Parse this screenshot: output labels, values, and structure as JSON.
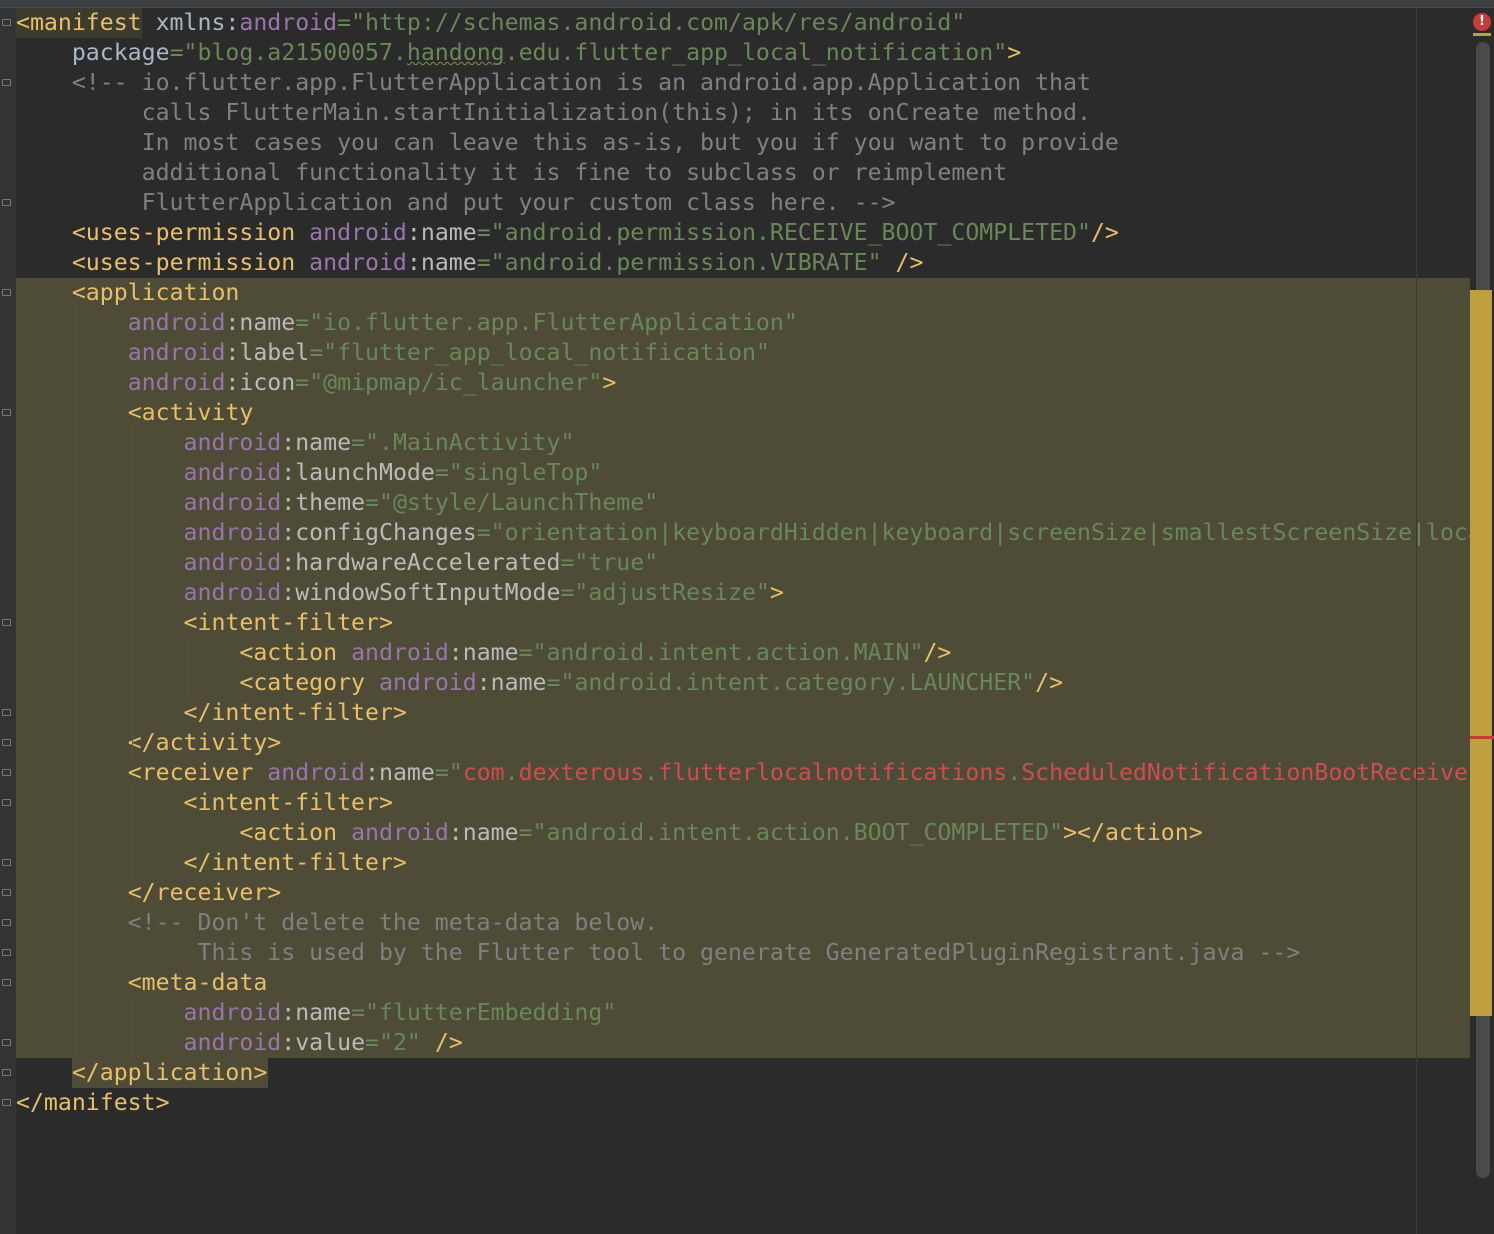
{
  "editor": {
    "error_icon": "!",
    "lines": [
      [
        [
          "tag",
          "<manifest"
        ],
        [
          "plain",
          " xmlns:"
        ],
        [
          "ns",
          "android"
        ],
        [
          "str",
          "=\"http://schemas.android.com/apk/res/android\""
        ]
      ],
      [
        [
          "plain",
          "    package"
        ],
        [
          "str",
          "=\"blog.a21500057."
        ],
        [
          "sq",
          "handong"
        ],
        [
          "str",
          ".edu.flutter_app_local_notification\""
        ],
        [
          "tag",
          ">"
        ]
      ],
      [
        [
          "cmt",
          "    <!-- io.flutter.app.FlutterApplication is an android.app.Application that"
        ]
      ],
      [
        [
          "cmt",
          "         calls FlutterMain.startInitialization(this); in its onCreate method."
        ]
      ],
      [
        [
          "cmt",
          "         In most cases you can leave this as-is, but you if you want to provide"
        ]
      ],
      [
        [
          "cmt",
          "         additional functionality it is fine to subclass or reimplement"
        ]
      ],
      [
        [
          "cmt",
          "         FlutterApplication and put your custom class here. -->"
        ]
      ],
      [
        [
          "plain",
          "    "
        ],
        [
          "tag",
          "<uses-permission "
        ],
        [
          "ns",
          "android"
        ],
        [
          "attr",
          ":name"
        ],
        [
          "str",
          "=\"android.permission.RECEIVE_BOOT_COMPLETED\""
        ],
        [
          "tag",
          "/>"
        ]
      ],
      [
        [
          "plain",
          "    "
        ],
        [
          "tag",
          "<uses-permission "
        ],
        [
          "ns",
          "android"
        ],
        [
          "attr",
          ":name"
        ],
        [
          "str",
          "=\"android.permission.VIBRATE\""
        ],
        [
          "plain",
          " "
        ],
        [
          "tag",
          "/>"
        ]
      ],
      [
        [
          "plain",
          "    "
        ],
        [
          "tag",
          "<application"
        ]
      ],
      [
        [
          "plain",
          "        "
        ],
        [
          "ns",
          "android"
        ],
        [
          "attr",
          ":name"
        ],
        [
          "str",
          "=\"io.flutter.app.FlutterApplication\""
        ]
      ],
      [
        [
          "plain",
          "        "
        ],
        [
          "ns",
          "android"
        ],
        [
          "attr",
          ":label"
        ],
        [
          "str",
          "=\"flutter_app_local_notification\""
        ]
      ],
      [
        [
          "plain",
          "        "
        ],
        [
          "ns",
          "android"
        ],
        [
          "attr",
          ":icon"
        ],
        [
          "str",
          "=\"@mipmap/ic_launcher\""
        ],
        [
          "tag",
          ">"
        ]
      ],
      [
        [
          "plain",
          "        "
        ],
        [
          "tag",
          "<activity"
        ]
      ],
      [
        [
          "plain",
          "            "
        ],
        [
          "ns",
          "android"
        ],
        [
          "attr",
          ":name"
        ],
        [
          "str",
          "=\".MainActivity\""
        ]
      ],
      [
        [
          "plain",
          "            "
        ],
        [
          "ns",
          "android"
        ],
        [
          "attr",
          ":launchMode"
        ],
        [
          "str",
          "=\"singleTop\""
        ]
      ],
      [
        [
          "plain",
          "            "
        ],
        [
          "ns",
          "android"
        ],
        [
          "attr",
          ":theme"
        ],
        [
          "str",
          "=\"@style/LaunchTheme\""
        ]
      ],
      [
        [
          "plain",
          "            "
        ],
        [
          "ns",
          "android"
        ],
        [
          "attr",
          ":configChanges"
        ],
        [
          "str",
          "=\"orientation|keyboardHidden|keyboard|screenSize|smallestScreenSize|locale|layoutDirection|fontScale|screenLayout|density|uiMode\""
        ]
      ],
      [
        [
          "plain",
          "            "
        ],
        [
          "ns",
          "android"
        ],
        [
          "attr",
          ":hardwareAccelerated"
        ],
        [
          "str",
          "=\"true\""
        ]
      ],
      [
        [
          "plain",
          "            "
        ],
        [
          "ns",
          "android"
        ],
        [
          "attr",
          ":windowSoftInputMode"
        ],
        [
          "str",
          "=\"adjustResize\""
        ],
        [
          "tag",
          ">"
        ]
      ],
      [
        [
          "plain",
          "            "
        ],
        [
          "tag",
          "<intent-filter>"
        ]
      ],
      [
        [
          "plain",
          "                "
        ],
        [
          "tag",
          "<action "
        ],
        [
          "ns",
          "android"
        ],
        [
          "attr",
          ":name"
        ],
        [
          "str",
          "=\"android.intent.action.MAIN\""
        ],
        [
          "tag",
          "/>"
        ]
      ],
      [
        [
          "plain",
          "                "
        ],
        [
          "tag",
          "<category "
        ],
        [
          "ns",
          "android"
        ],
        [
          "attr",
          ":name"
        ],
        [
          "str",
          "=\"android.intent.category.LAUNCHER\""
        ],
        [
          "tag",
          "/>"
        ]
      ],
      [
        [
          "plain",
          "            "
        ],
        [
          "tag",
          "</intent-filter>"
        ]
      ],
      [
        [
          "plain",
          "        "
        ],
        [
          "tag",
          "</activity>"
        ]
      ],
      [
        [
          "plain",
          "        "
        ],
        [
          "tag",
          "<receiver "
        ],
        [
          "ns",
          "android"
        ],
        [
          "attr",
          ":name"
        ],
        [
          "str",
          "=\""
        ],
        [
          "err",
          "com"
        ],
        [
          "str",
          "."
        ],
        [
          "err",
          "dexterous"
        ],
        [
          "str",
          "."
        ],
        [
          "err",
          "flutterlocalnotifications"
        ],
        [
          "str",
          "."
        ],
        [
          "err",
          "ScheduledNotificationBootReceiver"
        ],
        [
          "str",
          "\""
        ],
        [
          "tag",
          ">"
        ]
      ],
      [
        [
          "plain",
          "            "
        ],
        [
          "tag",
          "<intent-filter>"
        ]
      ],
      [
        [
          "plain",
          "                "
        ],
        [
          "tag",
          "<action "
        ],
        [
          "ns",
          "android"
        ],
        [
          "attr",
          ":name"
        ],
        [
          "str",
          "=\"android.intent.action.BOOT_COMPLETED\""
        ],
        [
          "tag",
          "></action>"
        ]
      ],
      [
        [
          "plain",
          "            "
        ],
        [
          "tag",
          "</intent-filter>"
        ]
      ],
      [
        [
          "plain",
          "        "
        ],
        [
          "tag",
          "</receiver>"
        ]
      ],
      [
        [
          "cmt",
          "        <!-- Don't delete the meta-data below."
        ]
      ],
      [
        [
          "cmt",
          "             This is used by the Flutter tool to generate GeneratedPluginRegistrant.java -->"
        ]
      ],
      [
        [
          "plain",
          "        "
        ],
        [
          "tag",
          "<meta-data"
        ]
      ],
      [
        [
          "plain",
          "            "
        ],
        [
          "ns",
          "android"
        ],
        [
          "attr",
          ":name"
        ],
        [
          "str",
          "=\"flutterEmbedding\""
        ]
      ],
      [
        [
          "plain",
          "            "
        ],
        [
          "ns",
          "android"
        ],
        [
          "attr",
          ":value"
        ],
        [
          "str",
          "=\"2\""
        ],
        [
          "plain",
          " "
        ],
        [
          "tag",
          "/>"
        ]
      ],
      [
        [
          "plain",
          "    "
        ],
        [
          "tag",
          "</application>"
        ]
      ],
      [
        [
          "tag",
          "</manifest>"
        ]
      ]
    ]
  }
}
